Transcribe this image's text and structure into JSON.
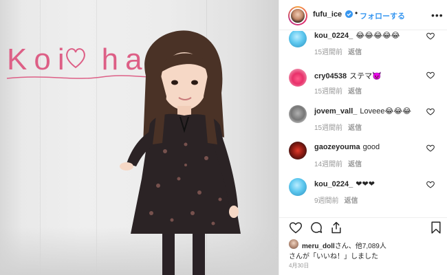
{
  "photo": {
    "logo_text_left": "Koi",
    "logo_text_right": "hada",
    "logo_color": "#dd5f86"
  },
  "header": {
    "username": "fufu_ice",
    "separator": "•",
    "follow_label": "フォローする",
    "more_icon": "more-horizontal-icon",
    "verified_color": "#3897f0"
  },
  "comments": [
    {
      "user": "kou_0224_",
      "text": "😂😂😂😂😂",
      "time": "15週間前",
      "reply": "返信"
    },
    {
      "user": "cry04538",
      "text": "ステマ👿",
      "time": "15週間前",
      "reply": "返信"
    },
    {
      "user": "jovem_vall_",
      "text": "Loveee😂😂😂",
      "time": "15週間前",
      "reply": "返信"
    },
    {
      "user": "gaozeyouma",
      "text": "good",
      "time": "14週間前",
      "reply": "返信"
    },
    {
      "user": "kou_0224_",
      "text": "❤❤❤",
      "time": "9週間前",
      "reply": "返信"
    }
  ],
  "actions": {
    "icons": [
      "heart-icon",
      "comment-icon",
      "share-icon",
      "bookmark-icon"
    ]
  },
  "likes": {
    "user": "meru_doll",
    "line1_suffix": "さん、他7,089人",
    "line2": "さんが「いいね！」しました"
  },
  "date": "4月30日"
}
